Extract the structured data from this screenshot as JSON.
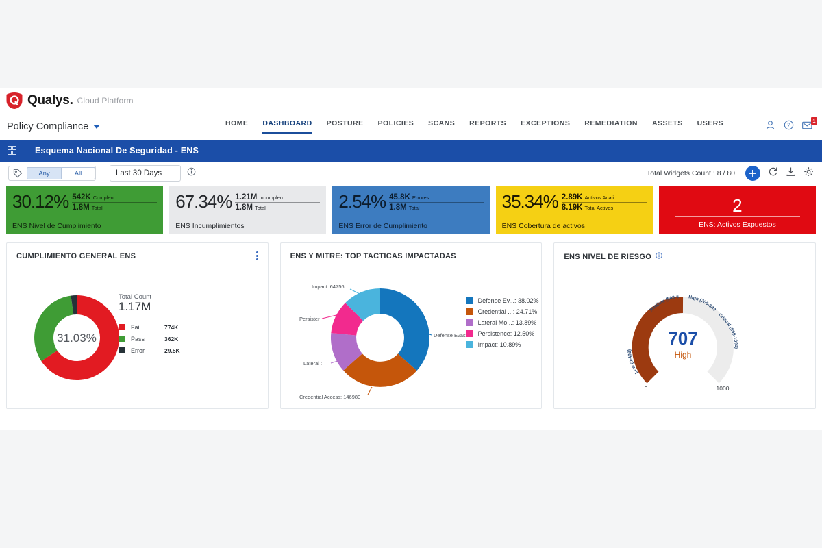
{
  "brand": {
    "name": "Qualys.",
    "suffix": "Cloud Platform",
    "logo_icon": "qualys-shield-icon"
  },
  "module_selector": {
    "label": "Policy Compliance",
    "icon": "chevron-down-icon"
  },
  "nav": {
    "items": [
      {
        "label": "HOME",
        "active": false
      },
      {
        "label": "DASHBOARD",
        "active": true
      },
      {
        "label": "POSTURE",
        "active": false
      },
      {
        "label": "POLICIES",
        "active": false
      },
      {
        "label": "SCANS",
        "active": false
      },
      {
        "label": "REPORTS",
        "active": false
      },
      {
        "label": "EXCEPTIONS",
        "active": false
      },
      {
        "label": "REMEDIATION",
        "active": false
      },
      {
        "label": "ASSETS",
        "active": false
      },
      {
        "label": "USERS",
        "active": false
      }
    ],
    "icons": [
      {
        "name": "user-icon"
      },
      {
        "name": "help-icon"
      },
      {
        "name": "mail-icon",
        "badge": "1"
      }
    ]
  },
  "dashboard_bar": {
    "title": "Esquema Nacional De Seguridad - ENS",
    "icon": "grid-view-icon"
  },
  "filters": {
    "tag_icon": "tag-icon",
    "segments": [
      {
        "label": "Any",
        "selected": true
      },
      {
        "label": "All",
        "selected": false
      }
    ],
    "date_range": {
      "value": "Last 30 Days",
      "icon": "chevron-down-icon"
    },
    "info_icon": "info-icon",
    "widget_count": "Total Widgets Count : 8 / 80",
    "actions": [
      {
        "name": "add-widget-button",
        "label": "+"
      },
      {
        "name": "refresh-icon"
      },
      {
        "name": "download-icon"
      },
      {
        "name": "settings-gear-icon"
      }
    ]
  },
  "kpis": [
    {
      "percent": "30.12%",
      "numerator": "542K",
      "numerator_label": "Cumplen",
      "denominator": "1.8M",
      "denominator_label": "Total",
      "caption": "ENS Nivel de Cumplimiento",
      "bg": "#3f9c35",
      "fg": "#10230d"
    },
    {
      "percent": "67.34%",
      "numerator": "1.21M",
      "numerator_label": "Incumplen",
      "denominator": "1.8M",
      "denominator_label": "Total",
      "caption": "ENS Incumplimientos",
      "bg": "#e8e9eb",
      "fg": "#25282c"
    },
    {
      "percent": "2.54%",
      "numerator": "45.8K",
      "numerator_label": "Errores",
      "denominator": "1.8M",
      "denominator_label": "Total",
      "caption": "ENS Error de Cumplimiento",
      "bg": "#3d7cc0",
      "fg": "#0c1c2d"
    },
    {
      "percent": "35.34%",
      "numerator": "2.89K",
      "numerator_label": "Activos Anali...",
      "denominator": "8.19K",
      "denominator_label": "Total Activos",
      "caption": "ENS Cobertura de activos",
      "bg": "#f5d014",
      "fg": "#1c1804"
    }
  ],
  "kpi_alert": {
    "value": "2",
    "caption": "ENS: Activos Expuestos",
    "bg": "#e00a12",
    "fg": "#ffffff"
  },
  "widgets": [
    {
      "title": "CUMPLIMIENTO GENERAL ENS",
      "menu_icon": "kebab-menu-icon",
      "center_label": "31.03%",
      "total_label": "Total Count",
      "total_value": "1.17M"
    },
    {
      "title": "ENS Y MITRE: TOP TACTICAS IMPACTADAS"
    },
    {
      "title": "ENS NIVEL DE RIESGO",
      "info_icon": "info-icon"
    }
  ],
  "chart_data": [
    {
      "type": "pie",
      "title": "CUMPLIMIENTO GENERAL ENS",
      "subtitle": "Total Count 1.17M",
      "center_text": "31.03%",
      "legend_position": "right",
      "labels": [
        "Fail",
        "Pass",
        "Error"
      ],
      "values": [
        774000,
        362000,
        29500
      ],
      "value_labels": [
        "774K",
        "362K",
        "29.5K"
      ],
      "percents": [
        66.44,
        31.03,
        2.53
      ],
      "colors": [
        "#e21b22",
        "#3f9c35",
        "#263238"
      ]
    },
    {
      "type": "pie",
      "title": "ENS Y MITRE: TOP TACTICAS IMPACTADAS",
      "legend_position": "right",
      "labels": [
        "Defense Evasion",
        "Credential Access",
        "Lateral Movement",
        "Persistence",
        "Impact"
      ],
      "legend_entries": [
        "Defense Ev...: 38.02%",
        "Credential ...: 24.71%",
        "Lateral Mo...: 13.89%",
        "Persistence: 12.50%",
        "Impact: 10.89%"
      ],
      "percents": [
        38.02,
        24.71,
        13.89,
        12.5,
        10.89
      ],
      "values": [
        226128,
        146980,
        82600,
        74350,
        64756
      ],
      "annotations": [
        "Defense Evasi...",
        "Credential Access: 146980",
        "Lateral :",
        "Persister",
        "Impact: 64756"
      ],
      "colors": [
        "#1476bd",
        "#c5560b",
        "#b06ec9",
        "#f22a8e",
        "#4ab4dd"
      ]
    },
    {
      "type": "gauge",
      "title": "ENS NIVEL DE RIESGO",
      "value": 707,
      "value_label": "707",
      "status": "High",
      "min": 0,
      "max": 1000,
      "min_label": "0",
      "max_label": "1000",
      "bands": [
        {
          "label": "Low (0-499)",
          "from": 0,
          "to": 499
        },
        {
          "label": "Medium (500-699)",
          "from": 500,
          "to": 699
        },
        {
          "label": "High (700-849)",
          "from": 700,
          "to": 849
        },
        {
          "label": "Critical (850-1000)",
          "from": 850,
          "to": 1000
        }
      ],
      "arc_color": "#9c3a10",
      "track_color": "#ececec",
      "value_color": "#1b4ea8",
      "status_color": "#c5560b"
    }
  ]
}
